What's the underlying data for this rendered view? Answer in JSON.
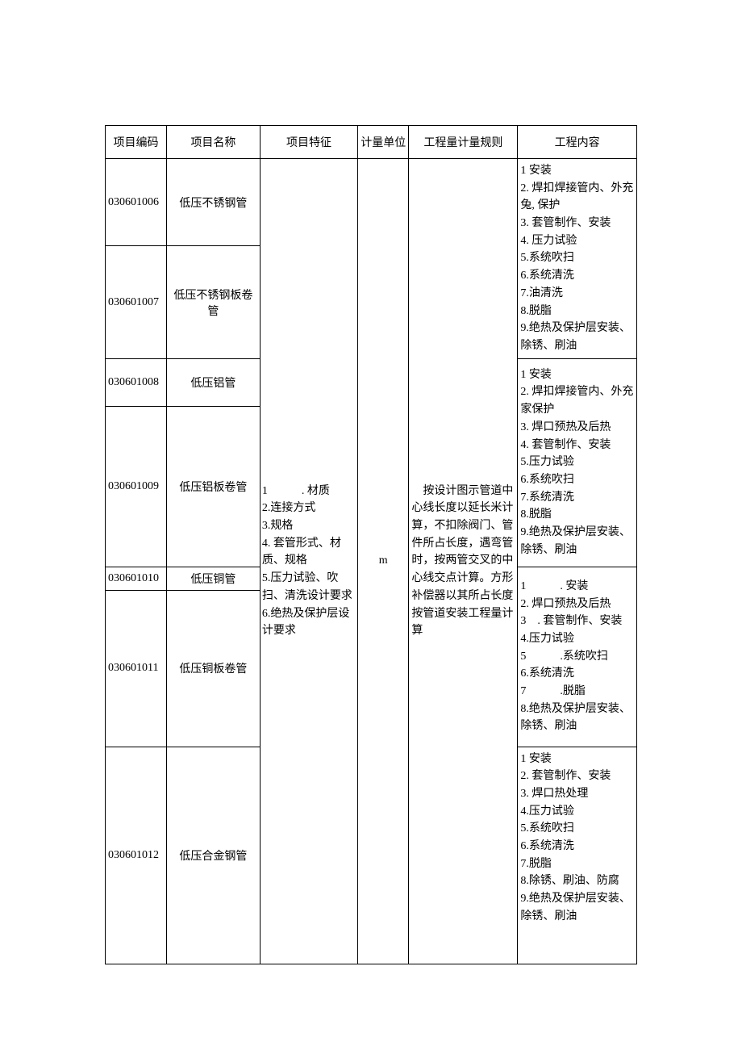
{
  "headers": {
    "code": "项目编码",
    "name": "项目名称",
    "feature": "项目特征",
    "unit": "计量单位",
    "rule": "工程量计量规则",
    "content": "工程内容"
  },
  "codes": {
    "r1": "030601006",
    "r2": "030601007",
    "r3": "030601008",
    "r4": "030601009",
    "r5": "030601010",
    "r6": "030601011",
    "r7": "030601012"
  },
  "names": {
    "r1": "低压不锈钢管",
    "r2": "低压不锈钢板卷管",
    "r3": "低压铝管",
    "r4": "低压铝板卷管",
    "r5": "低压铜管",
    "r6": "低压铜板卷管",
    "r7": "低压合金钢管"
  },
  "feature": {
    "l1": "1　　　. 材质",
    "l2": "2.连接方式",
    "l3": "3.规格",
    "l4": "4. 套管形式、材质、规格",
    "l5": "5.压力试验、吹扫、清洗设计要求",
    "l6": "6.绝热及保护层设计要求"
  },
  "unit": "m",
  "rule": "　按设计图示管道中心线长度以延长米计算，不扣除阀门、管件所占长度，遇弯管时，按两管交叉的中心线交点计算。方形补偿器以其所占长度按管道安装工程量计算",
  "content_a": {
    "l1": "1 安装",
    "l2": "2. 焊扣焊接管内、外充兔, 保护",
    "l3": "3. 套管制作、安装",
    "l4": "4. 压力试验",
    "l5": "5.系统吹扫",
    "l6": "6.系统清洗",
    "l7": "7.油清洗",
    "l8": "8.脱脂",
    "l9": "9.绝热及保护层安装、除锈、刷油"
  },
  "content_b": {
    "l1": "1 安装",
    "l2": "2. 焊扣焊接管内、外充家保护",
    "l3": "3. 焊口预热及后热",
    "l4": "4. 套管制作、安装",
    "l5": "5.压力试验",
    "l6": "6.系统吹扫",
    "l7": "7.系统清洗",
    "l8": "8.脱脂",
    "l9": "9.绝热及保护层安装、除锈、刷油"
  },
  "content_c": {
    "l1": "1　　　. 安装",
    "l2": "2. 焊口预热及后热",
    "l3": "3　. 套管制作、安装",
    "l4": "4.压力试验",
    "l5": "5　　　.系统吹扫",
    "l6": "6.系统清洗",
    "l7": "7　　　.脱脂",
    "l8": "8.绝热及保护层安装、除锈、刷油"
  },
  "content_d": {
    "l1": "1 安装",
    "l2": "2. 套管制作、安装",
    "l3": "3. 焊口热处理",
    "l4": "4.压力试验",
    "l5": "5.系统吹扫",
    "l6": "6.系统清洗",
    "l7": "7.脱脂",
    "l8": "8.除锈、刷油、防腐",
    "l9": "9.绝热及保护层安装、除锈、刷油"
  }
}
